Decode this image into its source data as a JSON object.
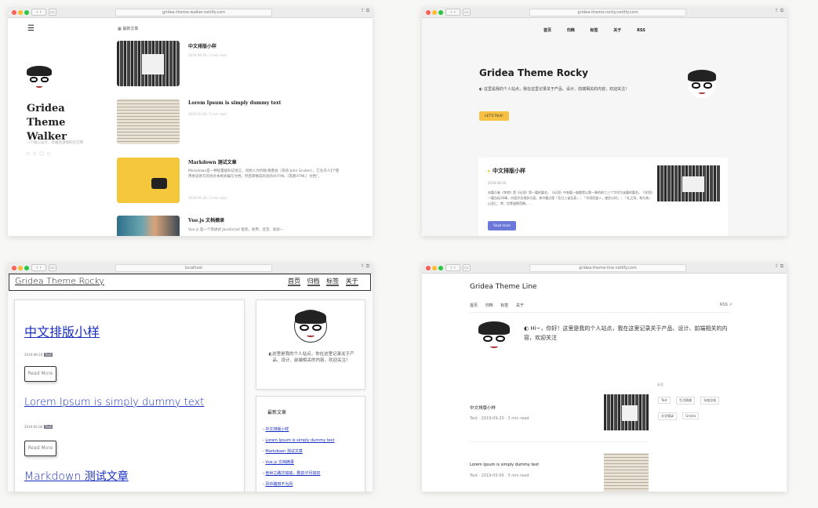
{
  "walker": {
    "url": "gridea-theme-walker.netlify.com",
    "menu_icon": "menu-icon",
    "section": "最新文章",
    "title": "Gridea Theme Walker",
    "desc": "一个核心设计，优雅且透明的社交网",
    "posts": [
      {
        "title": "中文排版小样",
        "meta": "2019-09-20 / 3 min read",
        "excerpt": ""
      },
      {
        "title": "Lorem Ipsum is simply dummy text",
        "meta": "2019-05-06 / 5 min read",
        "excerpt": ""
      },
      {
        "title": "Markdown 测试文章",
        "meta": "2019-04-30 / 3 min read",
        "excerpt": "Markdown是一种轻量级标记语言，创始人为约翰·格鲁伯（英语 John Gruber）。它允许人们\"使用易读易写的纯文本格式编写文档，然后转换成有效的XHTML（或者HTML）文档\"。"
      },
      {
        "title": "Vue.js 文档摘录",
        "meta": "",
        "excerpt": "Vue.js 是一个渐进式 JavaScript 框架，易用、灵活、高效—"
      }
    ]
  },
  "rocky": {
    "url": "gridea-theme-rocky.netlify.com",
    "nav": [
      "首页",
      "归档",
      "标签",
      "关于",
      "RSS"
    ],
    "title": "Gridea Theme Rocky",
    "intro": "这里是我的个人站点，我在这里记录关于产品、设计、前端相关的内容，欢迎关注！",
    "cta": "LET'S TALK!",
    "post_title": "中文排版小样",
    "post_date": "2019-09-20",
    "post_excerpt": "本篇引者《李商》是《论语》第一篇的篇名。《论语》中各篇一般都是以第一章的前二三个字作为该篇的篇名。《学而》一篇包括16章，内容涉及诸多方面。其中重点是「吾日三省吾身」；「节用而爱人，使民以时」；「礼之用，和为贵」以及仁、孝、信等道德范畴。...",
    "read_more": "Read more"
  },
  "rocky_hand": {
    "url": "localhost",
    "title": "Gridea Theme Rocky",
    "nav": [
      "首页",
      "归档",
      "标签",
      "关于"
    ],
    "posts": [
      {
        "title": "中文排版小样",
        "date": "2019-09-20",
        "tag": "Test"
      },
      {
        "title": "Lorem Ipsum is simply dummy text",
        "date": "2019-05-06",
        "tag": "Test"
      },
      {
        "title": "Markdown 测试文章",
        "date": "",
        "tag": ""
      }
    ],
    "read_more": "Read More",
    "about": "这里是我的个人站点，你在这里记录关于产品、设计、前端相关的内容，欢迎关注！",
    "recent_title": "最新文章",
    "recent": [
      "中文排版小样",
      "Lorem Ipsum is simply dummy text",
      "Markdown 测试文章",
      "Vue.js 文档摘录",
      "他世之路华如故，剧前汐月如初",
      "风中路田不为风"
    ]
  },
  "line": {
    "url": "gridea-theme-line.netlify.com",
    "title": "Gridea Theme Line",
    "nav": [
      "首页",
      "归档",
      "标签",
      "关于"
    ],
    "rss": "RSS",
    "intro": "Hi~，你好！这里是我的个人站点，我在这里记录关于产品、设计、前端相关的内容，欢迎关注",
    "tags_label": "标签",
    "tags": [
      "Test",
      "生活随感",
      "年度总结",
      "文学摘录",
      "Gridea"
    ],
    "posts": [
      {
        "title": "中文排版小样",
        "meta": "Test · 2019-09-20 · 3 min read"
      },
      {
        "title": "Lorem Ipsum is simply dummy text",
        "meta": "Test · 2019-05-06 · 5 min read"
      }
    ]
  }
}
